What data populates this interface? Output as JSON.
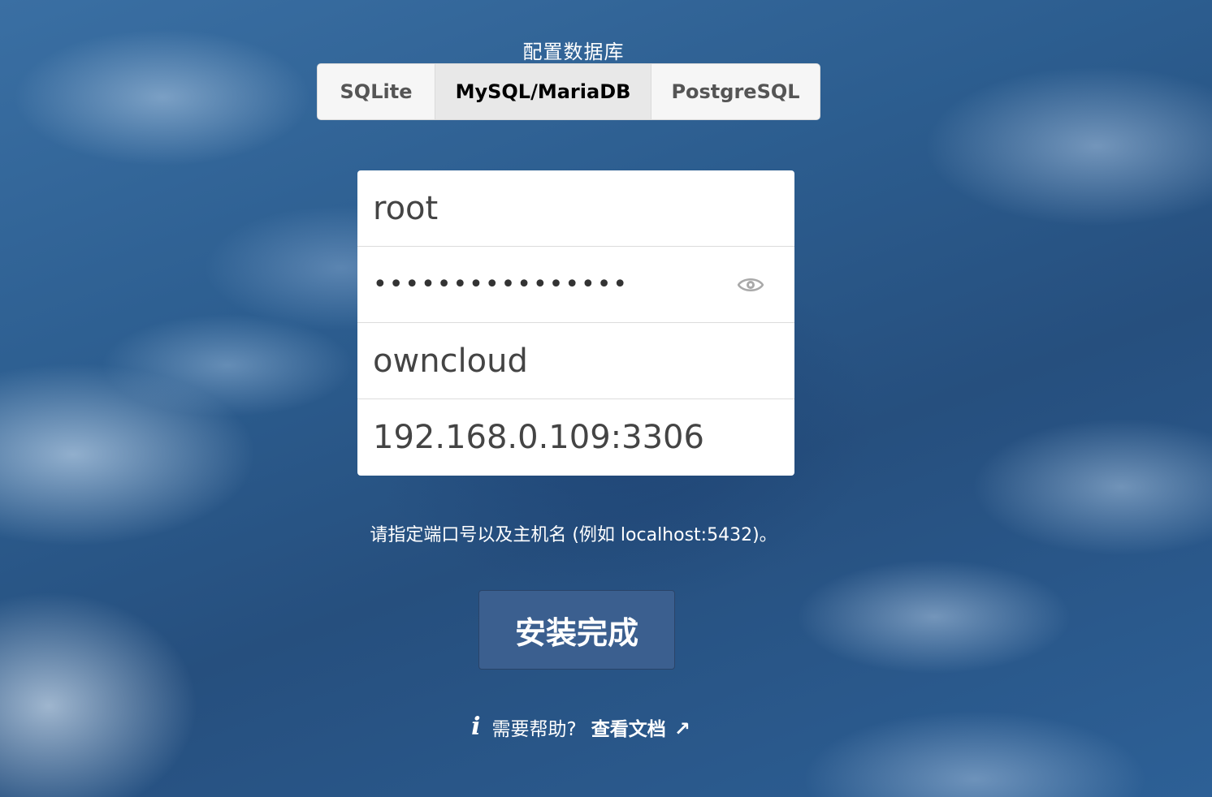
{
  "page": {
    "title": "配置数据库"
  },
  "db_tabs": {
    "items": [
      {
        "label": "SQLite",
        "active": false
      },
      {
        "label": "MySQL/MariaDB",
        "active": true
      },
      {
        "label": "PostgreSQL",
        "active": false
      }
    ]
  },
  "form": {
    "db_user": "root",
    "db_password_masked": "••••••••••••••••",
    "db_name": "owncloud",
    "db_host": "192.168.0.109:3306"
  },
  "hint": "请指定端口号以及主机名 (例如 localhost:5432)。",
  "install_button": "安装完成",
  "help": {
    "text": "需要帮助?",
    "link_label": "查看文档",
    "arrow": "↗",
    "info_glyph": "i"
  },
  "colors": {
    "button_bg": "#3b5f8f",
    "tab_active_bg": "#e8e8e8",
    "panel_bg": "#ffffff"
  }
}
